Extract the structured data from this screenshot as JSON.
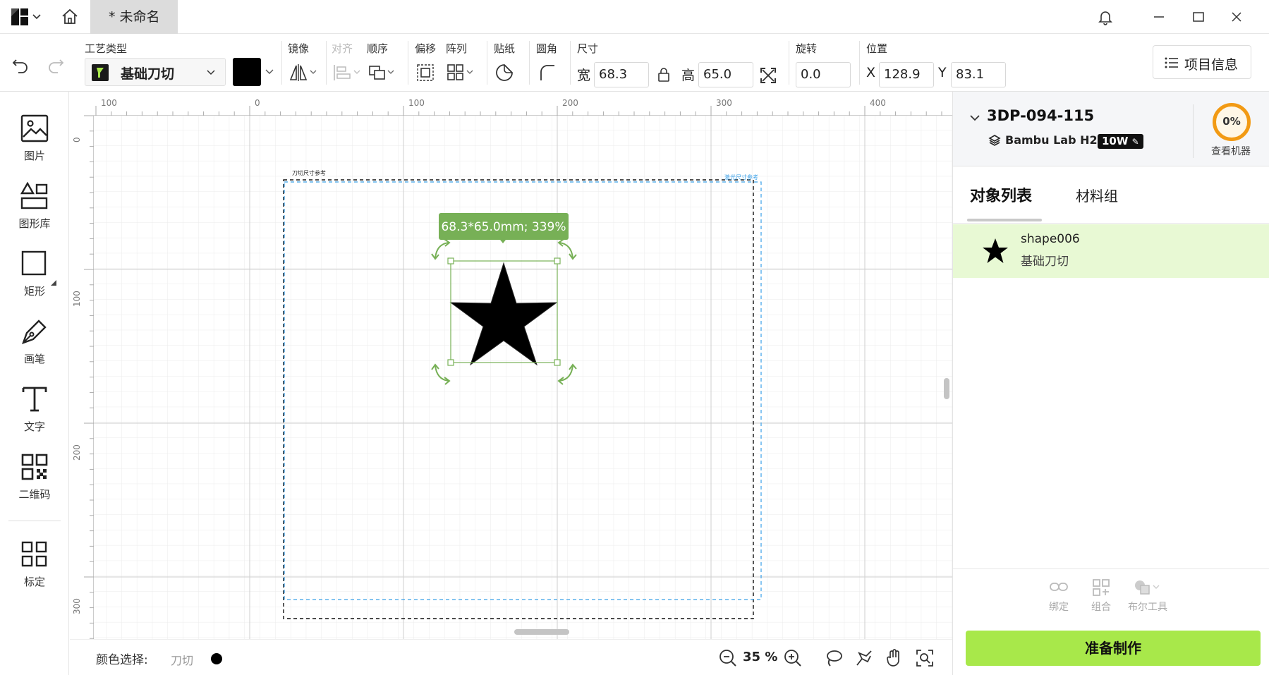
{
  "titlebar": {
    "tab_title": "* 未命名"
  },
  "toolbar": {
    "process_type_label": "工艺类型",
    "process_type_value": "基础刀切",
    "mirror_label": "镜像",
    "align_label": "对齐",
    "order_label": "顺序",
    "offset_label": "偏移",
    "array_label": "阵列",
    "sticker_label": "贴纸",
    "fillet_label": "圆角",
    "size_label": "尺寸",
    "width_label": "宽",
    "width_value": "68.3",
    "height_label": "高",
    "height_value": "65.0",
    "rotate_label": "旋转",
    "rotate_value": "0.0",
    "position_label": "位置",
    "x_label": "X",
    "x_value": "128.9",
    "y_label": "Y",
    "y_value": "83.1",
    "project_info_label": "项目信息",
    "fill_color": "#000000"
  },
  "leftrail": {
    "tools": [
      {
        "label": "图片",
        "icon": "image-icon"
      },
      {
        "label": "图形库",
        "icon": "shape-library-icon"
      },
      {
        "label": "矩形",
        "icon": "rectangle-icon"
      },
      {
        "label": "画笔",
        "icon": "pen-icon"
      },
      {
        "label": "文字",
        "icon": "text-icon"
      },
      {
        "label": "二维码",
        "icon": "qrcode-icon"
      },
      {
        "label": "标定",
        "icon": "calibrate-icon"
      }
    ]
  },
  "canvas": {
    "ruler_h_labels": [
      "100",
      "0",
      "100",
      "200",
      "300",
      "400"
    ],
    "ruler_v_labels": [
      "0",
      "100",
      "200",
      "300"
    ],
    "cut_ref_label": "刀切尺寸参考",
    "laser_ref_label": "激光尺寸参考",
    "size_tooltip": "68.3*65.0mm; 339%"
  },
  "statusbar": {
    "color_select_label": "颜色选择:",
    "color_option": "刀切",
    "zoom": "35 %"
  },
  "device": {
    "name": "3DP-094-115",
    "model": "Bambu Lab H2D",
    "power": "10W",
    "progress": "0%",
    "view_machine_label": "查看机器",
    "accent_color": "#f29a13"
  },
  "panel": {
    "tab_objects": "对象列表",
    "tab_materials": "材料组",
    "object": {
      "name": "shape006",
      "process": "基础刀切"
    },
    "bind_label": "绑定",
    "group_label": "组合",
    "boolean_label": "布尔工具",
    "make_button": "准备制作",
    "make_button_color": "#a8e84a"
  }
}
